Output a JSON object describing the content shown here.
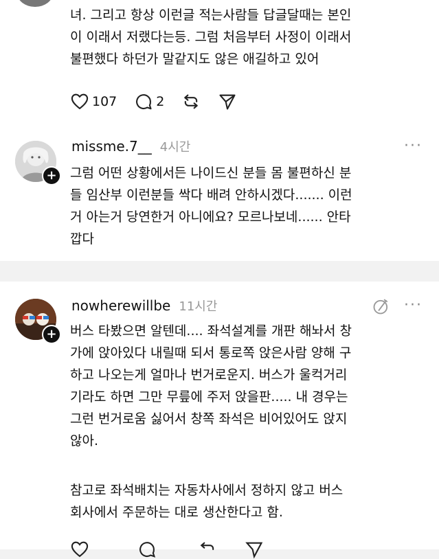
{
  "post_top": {
    "lines": [
      "녀. 그리고 항상 이런글 적는사람들 답글달때는 본인",
      "이 이래서 저랬다는등. 그럼 처음부터 사정이 이래서",
      "불편했다 하던가 말같지도 않은 애길하고 있어"
    ],
    "likes": "107",
    "replies": "2"
  },
  "comment1": {
    "username": "missme.7__",
    "time": "4시간",
    "more": "···",
    "lines": [
      "그럼 어떤 상황에서든 나이드신 분들 몸 불편하신 분",
      "들 임산부 이런분들 싹다 배려 안하시겠다....... 이런",
      "거 아는거 당연한거 아니에요? 모르나보네...... 안타",
      "깝다"
    ]
  },
  "comment2": {
    "username": "nowherewillbe",
    "time": "11시간",
    "more": "···",
    "lines": [
      "버스 타봤으면 알텐데.... 좌석설계를 개판 해놔서 창",
      "가에 앉아있다 내릴때 되서 통로쪽 앉은사람 양해 구",
      "하고 나오는게 얼마나 번거로운지. 버스가 울컥거리",
      "기라도 하면 그만 무릎에 주저 앉을판..... 내 경우는",
      "그런 번거로움 싫어서 창쪽 좌석은 비어있어도 앉지",
      "않아."
    ],
    "lines2": [
      "참고로 좌석배치는 자동차사에서 정하지 않고 버스",
      "회사에서 주문하는 대로 생산한다고 함."
    ]
  },
  "icons": {
    "like": "heart-icon",
    "reply": "comment-icon",
    "repost": "repost-icon",
    "share": "send-icon",
    "follow": "plus-icon",
    "edit": "edited-icon"
  },
  "colors": {
    "text": "#111111",
    "muted": "#999999",
    "background": "#ffffff",
    "separator": "#f2f2f2"
  }
}
